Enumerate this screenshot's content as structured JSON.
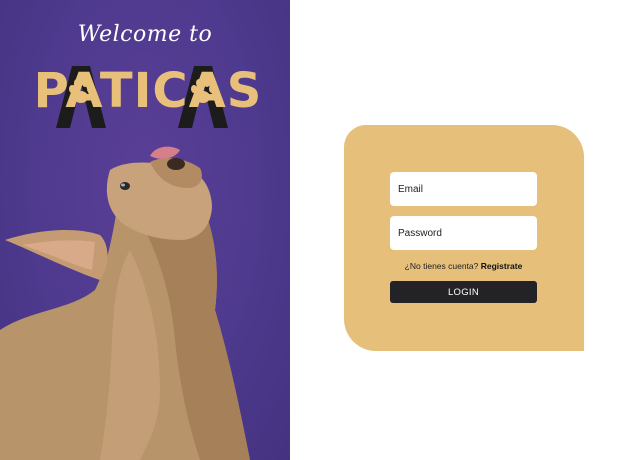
{
  "hero": {
    "welcome_text": "Welcome to",
    "brand_name": "PATICAS"
  },
  "login_form": {
    "email_placeholder": "Email",
    "password_placeholder": "Password",
    "signup_prompt": "¿No tienes cuenta?",
    "signup_link": "Registrate",
    "login_label": "LOGIN"
  },
  "colors": {
    "left_panel": "#4e3a8e",
    "card": "#e6bf7b",
    "button": "#232326"
  },
  "icons": [
    "paw-icon"
  ]
}
